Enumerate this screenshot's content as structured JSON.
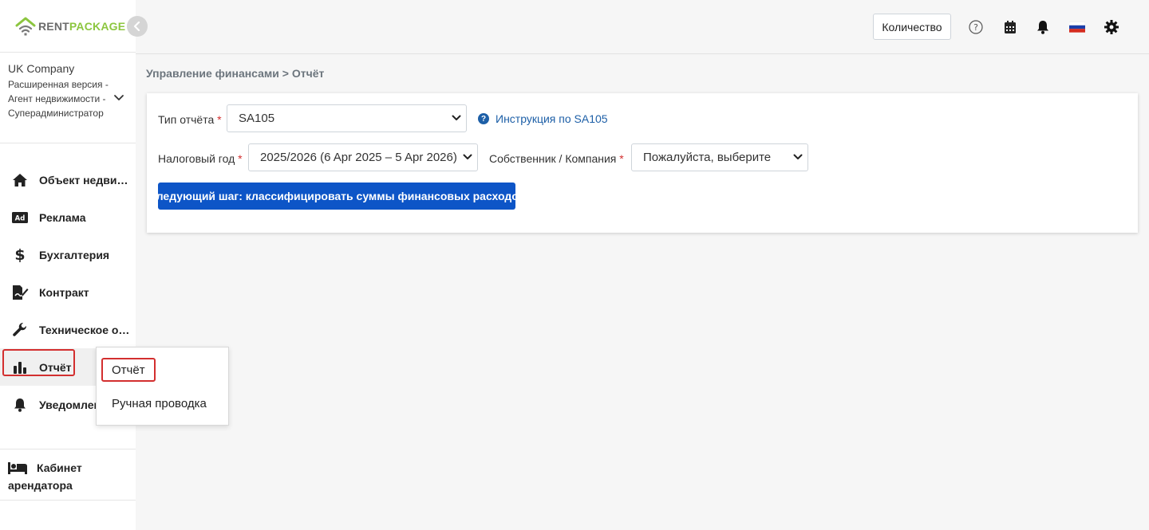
{
  "brand": {
    "name_part1": "RENT",
    "name_part2": "PACKAGE",
    "accent_color": "#8cc63f"
  },
  "company": {
    "name": "UK Company",
    "description": "Расширенная версия - Агент недвижимости - Суперадминистратор"
  },
  "sidebar": {
    "items": [
      {
        "label": "Объект недвижимости",
        "icon": "home-icon"
      },
      {
        "label": "Реклама",
        "icon": "ad-icon"
      },
      {
        "label": "Бухгалтерия",
        "icon": "dollar-icon"
      },
      {
        "label": "Контракт",
        "icon": "contract-icon"
      },
      {
        "label": "Техническое обслуживание",
        "icon": "wrench-icon"
      },
      {
        "label": "Отчёт",
        "icon": "bar-chart-icon",
        "active": true
      },
      {
        "label": "Уведомления",
        "icon": "bell-icon"
      }
    ],
    "tenant_line1": "Кабинет",
    "tenant_line2": "арендатора"
  },
  "header": {
    "quantity_button": "Количество",
    "icons": [
      "help-icon",
      "calendar-icon",
      "bell-icon",
      "russia-flag-icon",
      "gear-icon"
    ]
  },
  "breadcrumb": "Управление финансами > Отчёт",
  "form": {
    "report_type_label": "Тип отчёта",
    "report_type_value": "SA105",
    "help_link": "Инструкция по SA105",
    "tax_year_label": "Налоговый год",
    "tax_year_value": "2025/2026 (6 Apr 2025 – 5 Apr 2026)",
    "owner_label": "Собственник / Компания",
    "owner_value": "Пожалуйста, выберите",
    "next_button": "Следующий шаг: классифицировать суммы финансовых расходов",
    "required_mark": "*"
  },
  "flyout": {
    "items": [
      "Отчёт",
      "Ручная проводка"
    ]
  },
  "colors": {
    "primary": "#0d55c7",
    "highlight": "#d32f2f",
    "link": "#1d5fa7"
  }
}
